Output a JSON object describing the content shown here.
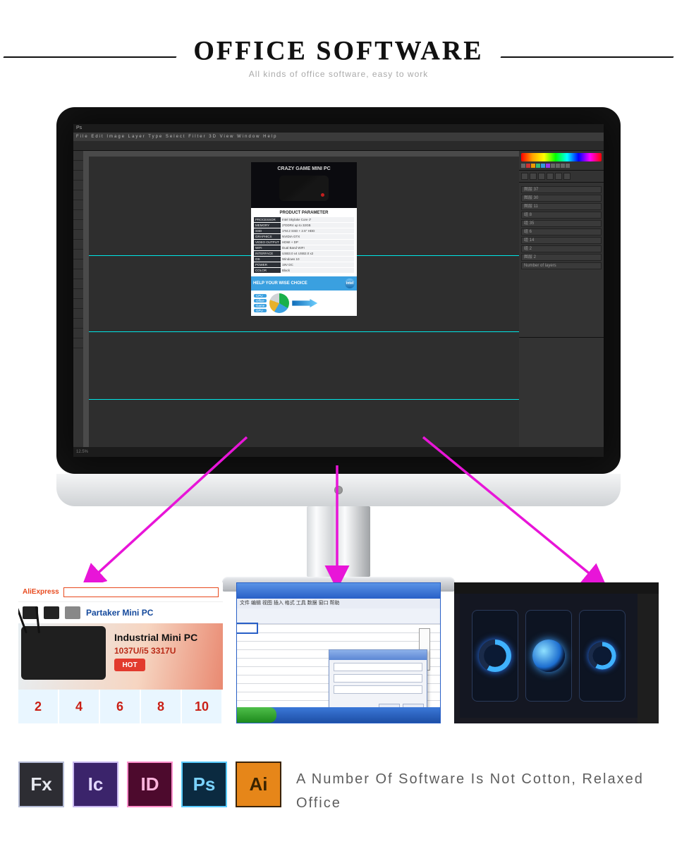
{
  "header": {
    "title": "OFFICE SOFTWARE",
    "subtitle": "All kinds of office software, easy to work"
  },
  "photoshop": {
    "app_label": "Ps",
    "menubar": "File  Edit  Image  Layer  Type  Select  Filter  3D  View  Window  Help",
    "status_zoom": "12.5%",
    "artboard": {
      "hero_title": "CRAZY GAME MINI PC",
      "section_title": "PRODUCT PARAMETER",
      "specs": [
        {
          "k": "PROCESSOR",
          "v": "Intel Skylake Core i7"
        },
        {
          "k": "MEMORY",
          "v": "2*DDR4 up to 32GB"
        },
        {
          "k": "SSD",
          "v": "1*M.2 SSD + 2.5'' HDD"
        },
        {
          "k": "GRAPHICS",
          "v": "NVIDIA GTX"
        },
        {
          "k": "VIDEO OUTPUT",
          "v": "HDMI + DP"
        },
        {
          "k": "WIFI",
          "v": "Dual Band WIFI"
        },
        {
          "k": "INTERFACE",
          "v": "USB3.0 x4 USB2.0 x2"
        },
        {
          "k": "OS",
          "v": "Windows 10"
        },
        {
          "k": "POWER",
          "v": "19V DC"
        },
        {
          "k": "COLOR",
          "v": "Black"
        }
      ],
      "blue_bar": "HELP YOUR WISE CHOICE",
      "blue_badge": "intel",
      "legend": [
        "CPU",
        "Office",
        "Game",
        "GPU"
      ]
    },
    "layers": [
      "图层 37",
      "图层 30",
      "图层 11",
      "组 8",
      "组 35",
      "组 6",
      "组 14",
      "组 2",
      "图层 2",
      "Number of layers"
    ]
  },
  "thumb1": {
    "store": "AliExpress",
    "brand": "Partaker Mini PC",
    "hero_title": "Industrial Mini PC",
    "hero_sub": "1037U/i5 3317U",
    "badge": "HOT",
    "numbers": [
      "2",
      "4",
      "6",
      "8",
      "10"
    ]
  },
  "thumb2": {
    "menu": "文件 编辑 视图 插入 格式 工具 数据 窗口 帮助"
  },
  "icons": {
    "fx": "Fx",
    "ic": "Ic",
    "id": "ID",
    "ps": "Ps",
    "ai": "Ai"
  },
  "footer_text": "A Number Of Software Is Not Cotton, Relaxed Office"
}
